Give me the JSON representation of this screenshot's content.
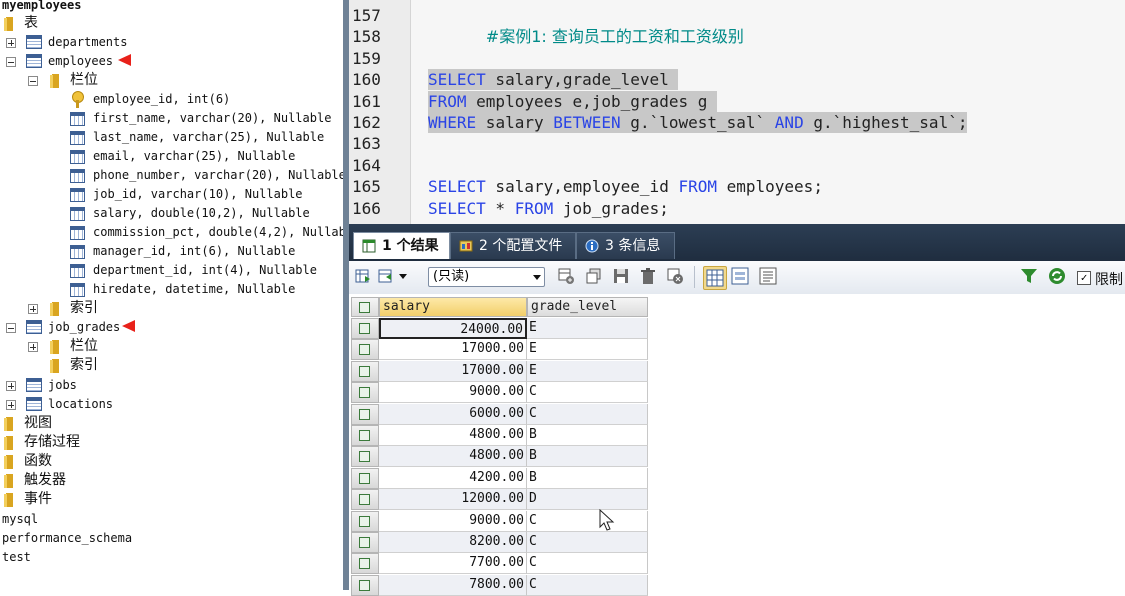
{
  "tree": {
    "db_name": "myemployees",
    "items": {
      "tables_folder": "表",
      "departments": "departments",
      "employees": "employees",
      "columns_folder": "栏位",
      "col_employee_id": "employee_id, int(6)",
      "col_first_name": "first_name, varchar(20), Nullable",
      "col_last_name": "last_name, varchar(25), Nullable",
      "col_email": "email, varchar(25), Nullable",
      "col_phone_number": "phone_number, varchar(20), Nullable",
      "col_job_id": "job_id, varchar(10), Nullable",
      "col_salary": "salary, double(10,2), Nullable",
      "col_commission_pct": "commission_pct, double(4,2), Nullable",
      "col_manager_id": "manager_id, int(6), Nullable",
      "col_department_id": "department_id, int(4), Nullable",
      "col_hiredate": "hiredate, datetime, Nullable",
      "index_folder": "索引",
      "job_grades": "job_grades",
      "jg_columns": "栏位",
      "jg_index": "索引",
      "jobs": "jobs",
      "locations": "locations",
      "views": "视图",
      "procedures": "存储过程",
      "functions": "函数",
      "triggers": "触发器",
      "events": "事件",
      "db_mysql": "mysql",
      "db_perf": "performance_schema",
      "db_test": "test"
    }
  },
  "editor": {
    "line_numbers": [
      "157",
      "158",
      "159",
      "160",
      "161",
      "162",
      "163",
      "164",
      "165",
      "166"
    ],
    "l157_comment": "#案例1: 查询员工的工资和工资级别",
    "l160_kw1": "SELECT",
    "l160_rest": " salary,grade_level ",
    "l161_kw1": "FROM",
    "l161_rest": " employees e,job_grades g ",
    "l162_kw1": "WHERE",
    "l162_mid": " salary ",
    "l162_kw2": "BETWEEN",
    "l162_mid2": " g.`lowest_sal` ",
    "l162_kw3": "AND",
    "l162_end": " g.`highest_sal`;",
    "l165_kw1": "SELECT",
    "l165_mid": " salary,employee_id ",
    "l165_kw2": "FROM",
    "l165_end": " employees;",
    "l166_kw1": "SELECT",
    "l166_mid": " * ",
    "l166_kw2": "FROM",
    "l166_end": " job_grades;"
  },
  "results": {
    "tabs": [
      "1 个结果",
      "2 个配置文件",
      "3 条信息"
    ],
    "readonly_label": "(只读)",
    "limit_label": "限制",
    "columns": [
      "salary",
      "grade_level"
    ],
    "rows": [
      {
        "salary": "24000.00",
        "grade": "E"
      },
      {
        "salary": "17000.00",
        "grade": "E"
      },
      {
        "salary": "17000.00",
        "grade": "E"
      },
      {
        "salary": "9000.00",
        "grade": "C"
      },
      {
        "salary": "6000.00",
        "grade": "C"
      },
      {
        "salary": "4800.00",
        "grade": "B"
      },
      {
        "salary": "4800.00",
        "grade": "B"
      },
      {
        "salary": "4200.00",
        "grade": "B"
      },
      {
        "salary": "12000.00",
        "grade": "D"
      },
      {
        "salary": "9000.00",
        "grade": "C"
      },
      {
        "salary": "8200.00",
        "grade": "C"
      },
      {
        "salary": "7700.00",
        "grade": "C"
      },
      {
        "salary": "7800.00",
        "grade": "C"
      }
    ]
  },
  "colors": {
    "keyword": "#2a44e6",
    "comment": "#008a88",
    "selection": "#c8c8c8",
    "tabbar": "#2c3e54",
    "annotation_arrow": "#e8211a"
  }
}
